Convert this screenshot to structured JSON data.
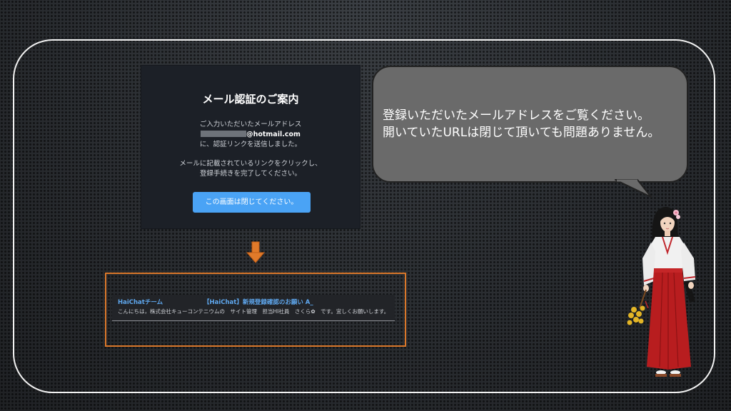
{
  "mail_card": {
    "title": "メール認証のご案内",
    "line1": "ご入力いただいたメールアドレス",
    "email_suffix": "@hotmail.com",
    "line2": "に、認証リンクを送信しました。",
    "line3": "メールに記載されているリンクをクリックし、",
    "line4": "登録手続きを完了してください。",
    "close_button": "この画面は閉じてください。"
  },
  "speech": {
    "line1": "登録いただいたメールアドレスをご覧ください。",
    "line2": "開いていたURLは閉じて頂いても問題ありません。"
  },
  "inbox": {
    "sender": "HaiChatチーム",
    "subject": "【HaiChat】新規登録確認のお願い A_",
    "snippet": "こんにちは，株式会社キューコンテニウムの　サイト管理　担当HI社員　さくら✿　です。宜しくお願いします。"
  },
  "colors": {
    "button": "#4aa3f5",
    "inbox_border": "#d9772a",
    "arrow": "#e07a2a",
    "link_text": "#5fa8ef"
  }
}
